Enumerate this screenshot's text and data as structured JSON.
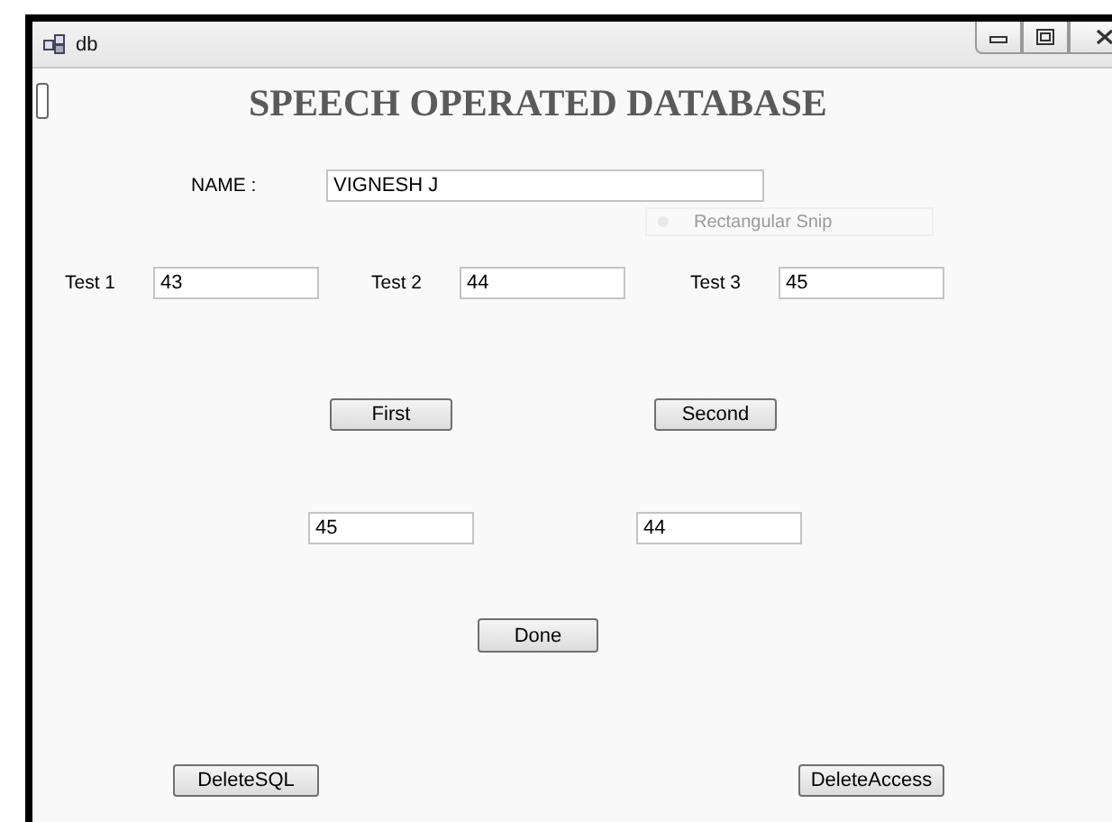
{
  "window": {
    "title": "db"
  },
  "heading": "SPEECH OPERATED DATABASE",
  "name_field": {
    "label": "NAME :",
    "value": "VIGNESH J"
  },
  "snip_overlay": {
    "label": "Rectangular Snip"
  },
  "tests": [
    {
      "label": "Test 1",
      "value": "43"
    },
    {
      "label": "Test 2",
      "value": "44"
    },
    {
      "label": "Test 3",
      "value": "45"
    }
  ],
  "choice_buttons": [
    "First",
    "Second"
  ],
  "results": [
    "45",
    "44"
  ],
  "done_button": "Done",
  "delete_buttons": [
    "DeleteSQL",
    "DeleteAccess"
  ]
}
